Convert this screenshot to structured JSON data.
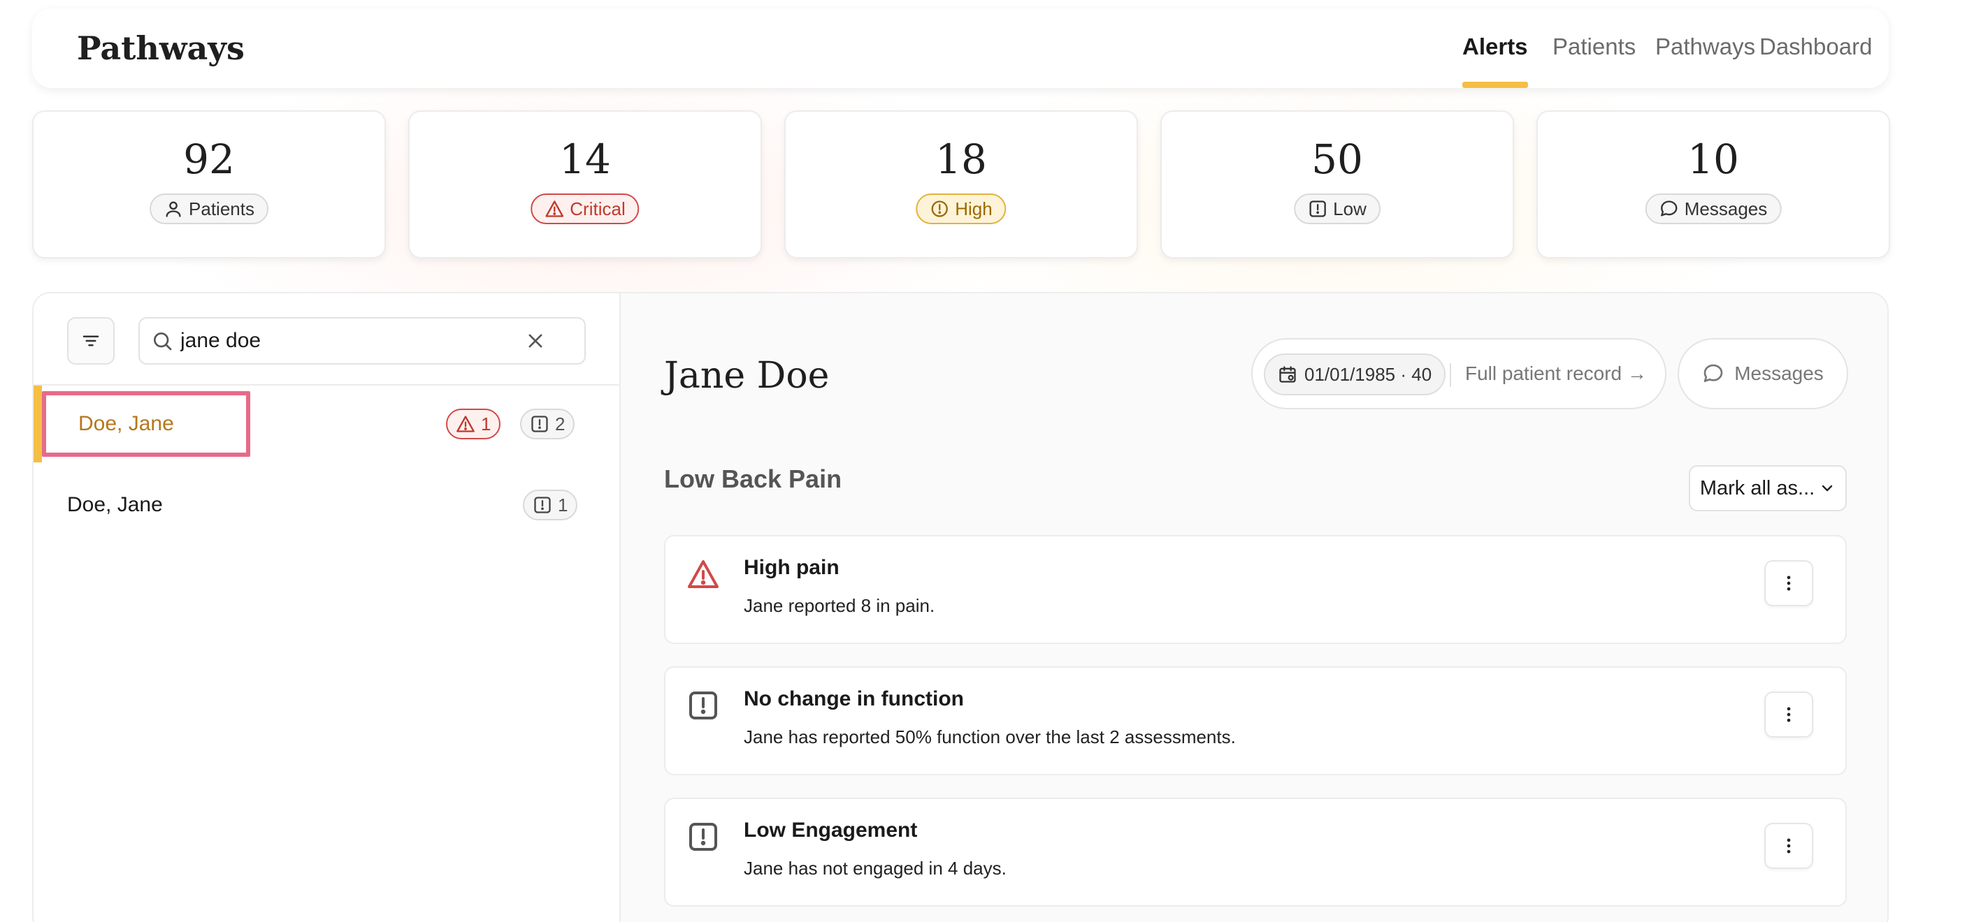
{
  "nav": {
    "brand": "Pathways",
    "tabs": [
      {
        "label": "Alerts",
        "active": true
      },
      {
        "label": "Patients",
        "active": false
      },
      {
        "label": "Pathways",
        "active": false
      },
      {
        "label": "Dashboard",
        "active": false
      }
    ]
  },
  "stats": [
    {
      "value": "92",
      "label": "Patients",
      "icon": "user-icon"
    },
    {
      "value": "14",
      "label": "Critical",
      "icon": "warning-triangle-icon"
    },
    {
      "value": "18",
      "label": "High",
      "icon": "alert-circle-icon"
    },
    {
      "value": "50",
      "label": "Low",
      "icon": "alert-square-icon"
    },
    {
      "value": "10",
      "label": "Messages",
      "icon": "message-bubble-icon"
    }
  ],
  "search": {
    "value": "jane doe",
    "placeholder": "Search"
  },
  "patients": [
    {
      "name": "Doe, Jane",
      "selected": true,
      "critical_count": "1",
      "low_count": "2"
    },
    {
      "name": "Doe, Jane",
      "selected": false,
      "low_count": "1"
    }
  ],
  "detail": {
    "name": "Jane Doe",
    "dob": "01/01/1985 · 40",
    "record_link": "Full patient record →",
    "messages_label": "Messages",
    "section_title": "Low Back Pain",
    "mark_all_label": "Mark all as...",
    "alerts": [
      {
        "title": "High pain",
        "description": "Jane reported 8 in pain.",
        "severity": "critical",
        "icon": "warning-triangle-icon"
      },
      {
        "title": "No change in function",
        "description": "Jane has reported 50% function over the last 2 assessments.",
        "severity": "low",
        "icon": "alert-square-icon"
      },
      {
        "title": "Low Engagement",
        "description": "Jane has not engaged in 4 days.",
        "severity": "low",
        "icon": "alert-square-icon"
      }
    ]
  },
  "colors": {
    "accent": "#f5bf45",
    "critical": "#d04a4a",
    "high": "#e2b23c",
    "selected_text": "#b5781b",
    "highlight_box": "#e86a8a"
  }
}
